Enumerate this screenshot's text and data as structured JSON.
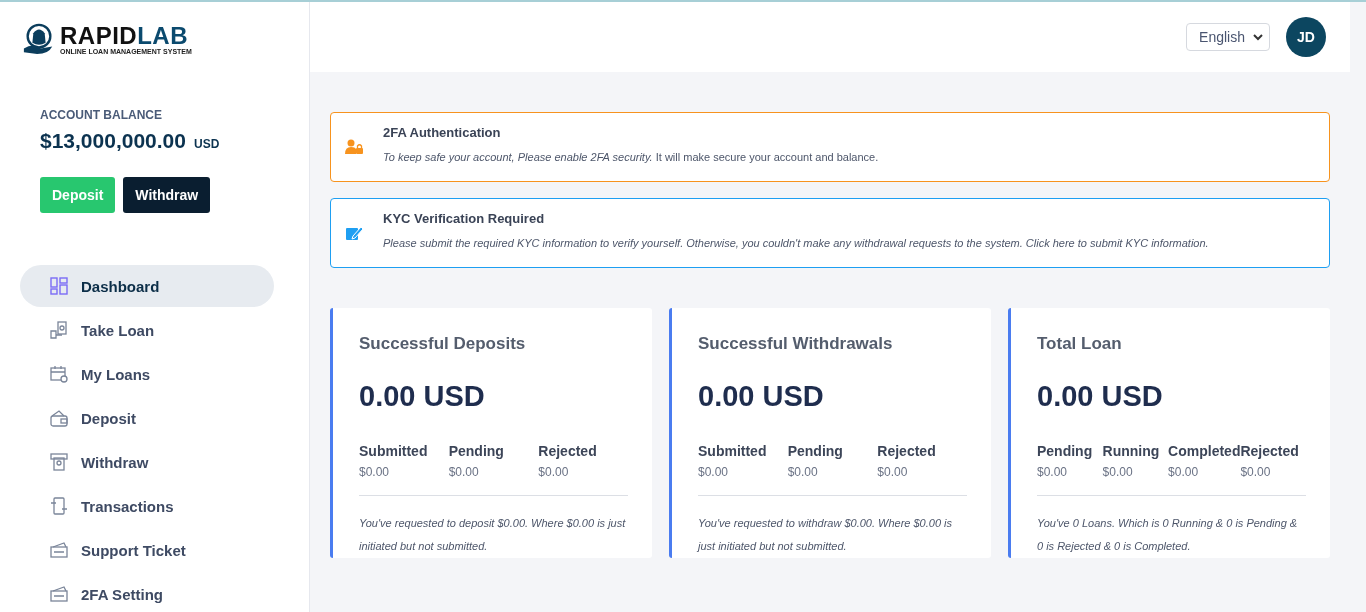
{
  "logo": {
    "name_dark": "RAPID",
    "name_accent": "LAB",
    "tagline": "ONLINE LOAN MANAGEMENT SYSTEM"
  },
  "balance": {
    "label": "ACCOUNT BALANCE",
    "amount": "$13,000,000.00",
    "currency": "USD"
  },
  "balance_buttons": [
    "Deposit",
    "Withdraw"
  ],
  "sidebar": {
    "items": [
      {
        "label": "Dashboard",
        "selected": true
      },
      {
        "label": "Take Loan",
        "selected": false
      },
      {
        "label": "My Loans",
        "selected": false
      },
      {
        "label": "Deposit",
        "selected": false
      },
      {
        "label": "Withdraw",
        "selected": false
      },
      {
        "label": "Transactions",
        "selected": false
      },
      {
        "label": "Support Ticket",
        "selected": false
      },
      {
        "label": "2FA Setting",
        "selected": false
      }
    ]
  },
  "header": {
    "language": "English",
    "avatar": "JD"
  },
  "alerts": [
    {
      "title": "2FA Authentication",
      "text": "*To keep safe your account, Please enable 2FA security.* It will make secure your account and balance.",
      "color": "#f7931e"
    },
    {
      "title": "KYC Verification Required",
      "text": "*Please submit the required KYC information to verify yourself. Otherwise, you couldn't make any withdrawal requests to the system. Click here to submit KYC information.*",
      "color": "#1e9ff2"
    }
  ],
  "cards": [
    {
      "title": "Successful Deposits",
      "amount": "0.00 USD",
      "stats": [
        {
          "label": "Submitted",
          "value": "$0.00"
        },
        {
          "label": "Pending",
          "value": "$0.00"
        },
        {
          "label": "Rejected",
          "value": "$0.00"
        }
      ],
      "note": "You've requested to deposit $0.00. Where $0.00 is just initiated but not submitted."
    },
    {
      "title": "Successful Withdrawals",
      "amount": "0.00 USD",
      "stats": [
        {
          "label": "Submitted",
          "value": "$0.00"
        },
        {
          "label": "Pending",
          "value": "$0.00"
        },
        {
          "label": "Rejected",
          "value": "$0.00"
        }
      ],
      "note": "You've requested to withdraw $0.00. Where $0.00 is just initiated but not submitted."
    },
    {
      "title": "Total Loan",
      "amount": "0.00 USD",
      "stats": [
        {
          "label": "Pending",
          "value": "$0.00"
        },
        {
          "label": "Running",
          "value": "$0.00"
        },
        {
          "label": "Completed",
          "value": "$0.00"
        },
        {
          "label": "Rejected",
          "value": "$0.00"
        }
      ],
      "note": "You've 0 Loans. Which is 0 Running & 0 is Pending & 0 is Rejected & 0 is Completed."
    }
  ]
}
